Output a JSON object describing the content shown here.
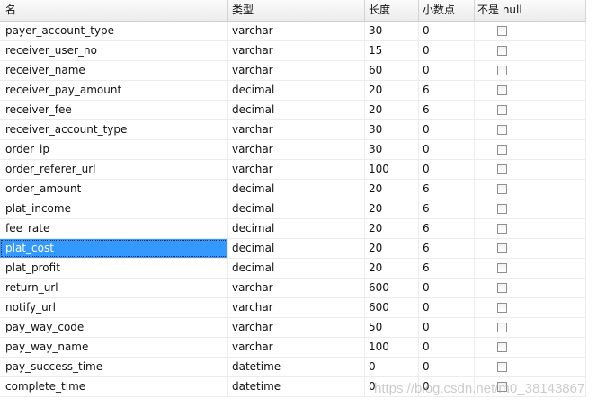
{
  "columns": [
    "名",
    "类型",
    "长度",
    "小数点",
    "不是 null"
  ],
  "rows": [
    {
      "name": "payer_account_type",
      "type": "varchar",
      "length": "30",
      "decimals": "0",
      "not_null": false
    },
    {
      "name": "receiver_user_no",
      "type": "varchar",
      "length": "15",
      "decimals": "0",
      "not_null": false
    },
    {
      "name": "receiver_name",
      "type": "varchar",
      "length": "60",
      "decimals": "0",
      "not_null": false
    },
    {
      "name": "receiver_pay_amount",
      "type": "decimal",
      "length": "20",
      "decimals": "6",
      "not_null": false
    },
    {
      "name": "receiver_fee",
      "type": "decimal",
      "length": "20",
      "decimals": "6",
      "not_null": false
    },
    {
      "name": "receiver_account_type",
      "type": "varchar",
      "length": "30",
      "decimals": "0",
      "not_null": false
    },
    {
      "name": "order_ip",
      "type": "varchar",
      "length": "30",
      "decimals": "0",
      "not_null": false
    },
    {
      "name": "order_referer_url",
      "type": "varchar",
      "length": "100",
      "decimals": "0",
      "not_null": false
    },
    {
      "name": "order_amount",
      "type": "decimal",
      "length": "20",
      "decimals": "6",
      "not_null": false
    },
    {
      "name": "plat_income",
      "type": "decimal",
      "length": "20",
      "decimals": "6",
      "not_null": false
    },
    {
      "name": "fee_rate",
      "type": "decimal",
      "length": "20",
      "decimals": "6",
      "not_null": false
    },
    {
      "name": "plat_cost",
      "type": "decimal",
      "length": "20",
      "decimals": "6",
      "not_null": false,
      "selected": true
    },
    {
      "name": "plat_profit",
      "type": "decimal",
      "length": "20",
      "decimals": "6",
      "not_null": false
    },
    {
      "name": "return_url",
      "type": "varchar",
      "length": "600",
      "decimals": "0",
      "not_null": false
    },
    {
      "name": "notify_url",
      "type": "varchar",
      "length": "600",
      "decimals": "0",
      "not_null": false
    },
    {
      "name": "pay_way_code",
      "type": "varchar",
      "length": "50",
      "decimals": "0",
      "not_null": false
    },
    {
      "name": "pay_way_name",
      "type": "varchar",
      "length": "100",
      "decimals": "0",
      "not_null": false
    },
    {
      "name": "pay_success_time",
      "type": "datetime",
      "length": "0",
      "decimals": "0",
      "not_null": false
    },
    {
      "name": "complete_time",
      "type": "datetime",
      "length": "0",
      "decimals": "0",
      "not_null": false
    }
  ],
  "watermark": "https://blog.csdn.net/m0_38143867",
  "colors": {
    "selection": "#3399ff",
    "grid_line": "#ececec"
  }
}
